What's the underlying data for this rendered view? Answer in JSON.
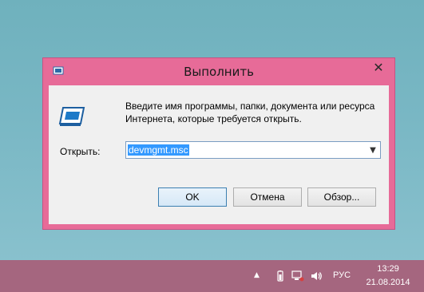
{
  "dialog": {
    "title": "Выполнить",
    "description": "Введите имя программы, папки, документа или ресурса Интернета, которые требуется открыть.",
    "open_label": "Открыть:",
    "input_value": "devmgmt.msc",
    "buttons": {
      "ok": "OK",
      "cancel": "Отмена",
      "browse": "Обзор..."
    },
    "icons": {
      "title": "run-app-icon",
      "main": "run-dialog-icon",
      "close": "close-icon",
      "dropdown": "chevron-down-icon"
    }
  },
  "taskbar": {
    "language": "РУС",
    "time": "13:29",
    "date": "21.08.2014",
    "icons": [
      "show-hidden-icons-chevron",
      "battery-icon",
      "network-icon",
      "volume-icon"
    ]
  },
  "colors": {
    "dialog_frame": "#e76b98",
    "taskbar": "#a5667f",
    "desktop": "#79b7c4",
    "selection": "#3399ff"
  }
}
